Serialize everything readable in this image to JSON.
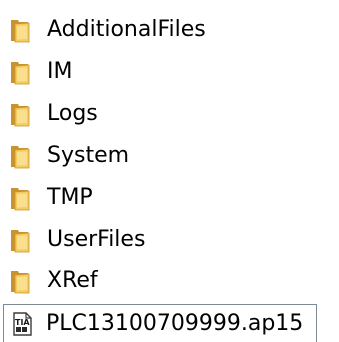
{
  "items": [
    {
      "name": "AdditionalFiles",
      "icon": "folder-icon",
      "type": "folder"
    },
    {
      "name": "IM",
      "icon": "folder-icon",
      "type": "folder"
    },
    {
      "name": "Logs",
      "icon": "folder-icon",
      "type": "folder"
    },
    {
      "name": "System",
      "icon": "folder-icon",
      "type": "folder"
    },
    {
      "name": "TMP",
      "icon": "folder-icon",
      "type": "folder"
    },
    {
      "name": "UserFiles",
      "icon": "folder-icon",
      "type": "folder"
    },
    {
      "name": "XRef",
      "icon": "folder-icon",
      "type": "folder"
    },
    {
      "name": "PLC13100709999.ap15",
      "icon": "project-file-icon",
      "type": "file",
      "selected": true
    }
  ],
  "colors": {
    "folder_back": "#c9932f",
    "folder_front": "#f4cd5c",
    "folder_highlight": "#fff1b8",
    "selection_border": "#7f8a96"
  }
}
